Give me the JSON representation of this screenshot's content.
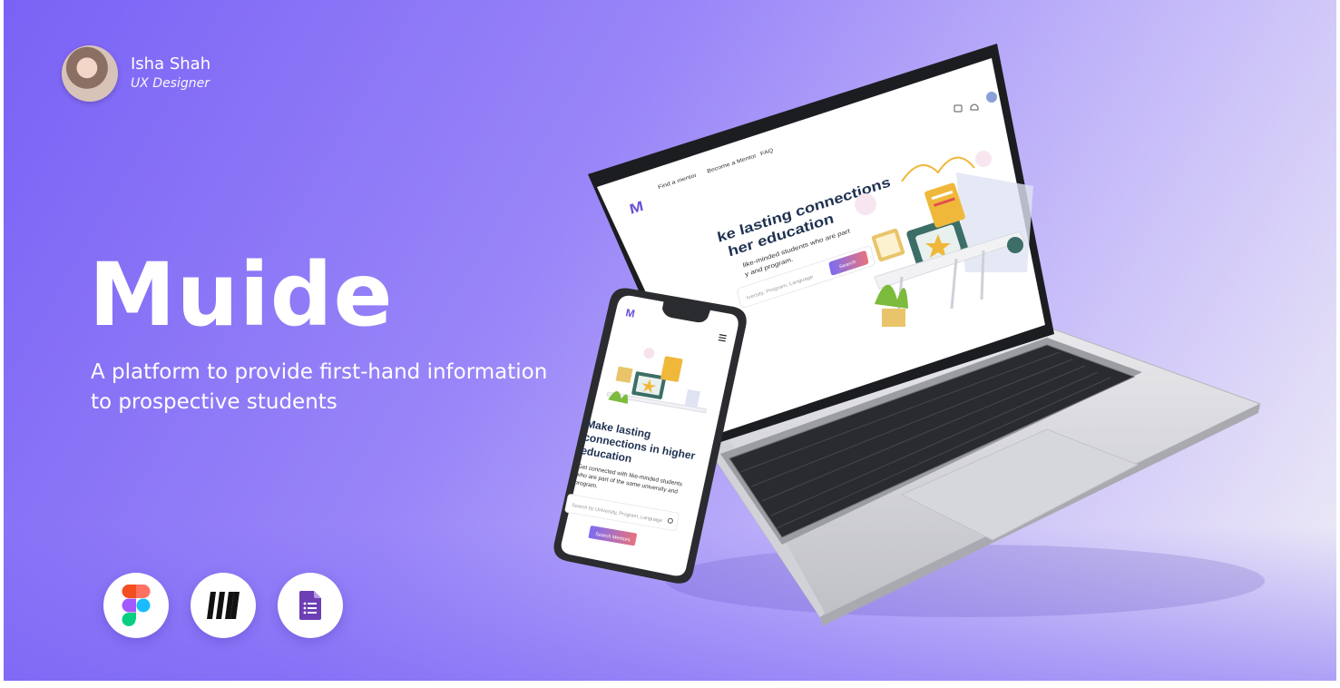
{
  "author": {
    "name": "Isha Shah",
    "role": "UX Designer"
  },
  "project": {
    "title": "Muide",
    "subtitle": "A platform to provide first-hand information to prospective students"
  },
  "tools": [
    {
      "icon": "figma-icon"
    },
    {
      "icon": "miro-icon"
    },
    {
      "icon": "google-forms-icon"
    }
  ],
  "laptop_screen": {
    "nav": [
      "Find a mentor",
      "Become a Mentor",
      "FAQ"
    ],
    "headline_1": "ke lasting connections",
    "headline_2": "her education",
    "body_1": "like-minded students who are part",
    "body_2": "y and program.",
    "search_placeholder": "Iversity, Program, Language",
    "search_button": "Search"
  },
  "phone_screen": {
    "headline_1": "Make lasting",
    "headline_2": "connections in higher",
    "headline_3": "education",
    "body_1": "Get connected with like-minded students",
    "body_2": "who are part of the same university and",
    "body_3": "program.",
    "search_placeholder": "Search by University, Program, Language",
    "search_button": "Search Mentors"
  },
  "colors": {
    "accent": "#7a62f5",
    "button_gradient_start": "#7b6cf2",
    "button_gradient_end": "#e8727e",
    "heading": "#1f3150"
  }
}
